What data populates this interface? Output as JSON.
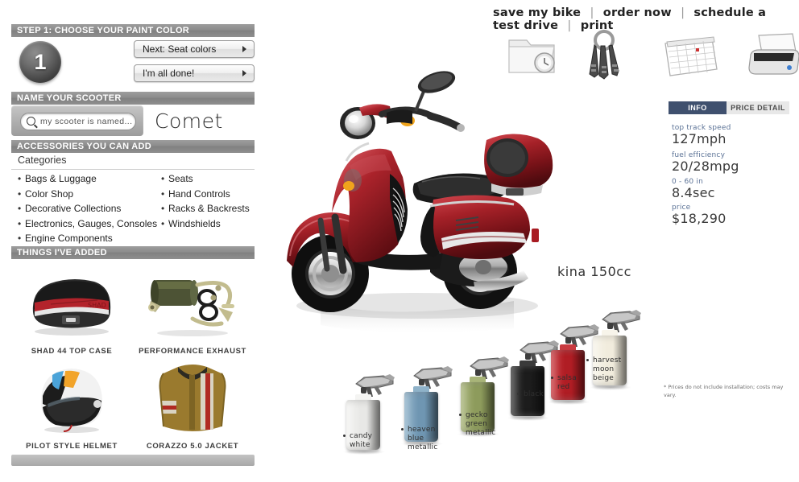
{
  "left_panel": {
    "step_header": "STEP 1: CHOOSE YOUR PAINT COLOR",
    "step_number": "1",
    "buttons": [
      {
        "label": "Next: Seat colors",
        "icon": "chevron-right-icon"
      },
      {
        "label": "I'm all done!",
        "icon": "chevron-right-icon"
      }
    ],
    "name_header": "NAME YOUR SCOOTER",
    "name_input": {
      "placeholder": "my scooter is named...",
      "value": "",
      "icon": "search-icon"
    },
    "scooter_name": "Comet",
    "accessories_header": "ACCESSORIES YOU CAN ADD",
    "categories_label": "Categories",
    "categories_left": [
      "Bags & Luggage",
      "Color Shop",
      "Decorative Collections",
      "Electronics, Gauges, Consoles",
      "Engine Components"
    ],
    "categories_right": [
      "Seats",
      "Hand Controls",
      "Racks & Backrests",
      "Windshields"
    ],
    "added_header": "THINGS I'VE ADDED",
    "added_items": [
      {
        "caption": "SHAD 44 TOP CASE",
        "icon": "top-case-thumbnail"
      },
      {
        "caption": "PERFORMANCE EXHAUST",
        "icon": "exhaust-thumbnail"
      },
      {
        "caption": "PILOT STYLE HELMET",
        "icon": "helmet-thumbnail"
      },
      {
        "caption": "CORAZZO 5.0 JACKET",
        "icon": "jacket-thumbnail"
      }
    ]
  },
  "toolbar": {
    "links": [
      {
        "label": "save my bike",
        "icon": "folder-clock-icon"
      },
      {
        "label": "order now",
        "icon": "keys-icon"
      },
      {
        "label": "schedule a test drive",
        "icon": "calendar-icon"
      },
      {
        "label": "print",
        "icon": "printer-icon"
      }
    ],
    "separator": "|"
  },
  "info_panel": {
    "tabs": [
      {
        "label": "INFO",
        "active": true
      },
      {
        "label": "PRICE DETAIL",
        "active": false
      }
    ],
    "specs": [
      {
        "label": "top track speed",
        "value": "127mph"
      },
      {
        "label": "fuel efficiency",
        "value": "20/28mpg"
      },
      {
        "label": "0 - 60 in",
        "value": "8.4sec"
      },
      {
        "label": "price",
        "value": "$18,290"
      }
    ],
    "disclaimer": "* Prices do not include installation; costs may vary."
  },
  "stage": {
    "model_label": "kina 150cc",
    "current_paint": "salsa red",
    "current_paint_hex": "#9d1f28"
  },
  "paint_colors": [
    {
      "name": "candy\nwhite",
      "hex": "#e8e8e6",
      "top": "#f4f4f2"
    },
    {
      "name": "heaven\nblue\nmetallic",
      "hex": "#6f96b2",
      "top": "#8fb2c9"
    },
    {
      "name": "gecko\ngreen\nmetallic",
      "hex": "#8d9b5c",
      "top": "#a8b478"
    },
    {
      "name": "black",
      "hex": "#1c1c1c",
      "top": "#3a3a3a"
    },
    {
      "name": "salsa\nred",
      "hex": "#b01d24",
      "top": "#c93a40"
    },
    {
      "name": "harvest\nmoon\nbeige",
      "hex": "#f1ecdd",
      "top": "#f7f4ea"
    }
  ],
  "theme": {
    "bar_gray": "#8c8c8c",
    "tab_active": "#3f506e",
    "spec_label": "#5b7296"
  }
}
